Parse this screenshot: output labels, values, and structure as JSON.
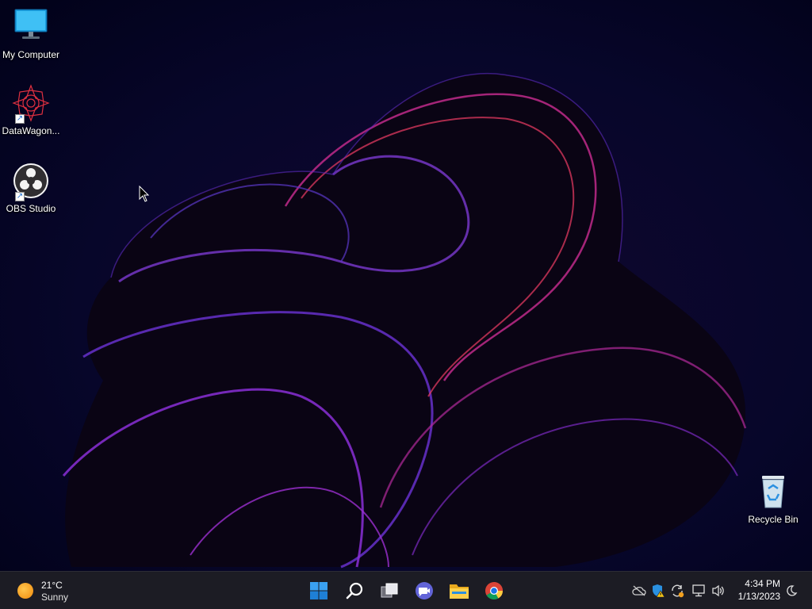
{
  "desktop": {
    "icons": [
      {
        "label": "My Computer",
        "icon": "monitor-icon"
      },
      {
        "label": "DataWagon...",
        "icon": "datawagon-logo-icon"
      },
      {
        "label": "OBS Studio",
        "icon": "obs-studio-icon"
      },
      {
        "label": "Recycle Bin",
        "icon": "recycle-bin-icon"
      }
    ]
  },
  "taskbar": {
    "weather": {
      "temperature": "21°C",
      "condition": "Sunny",
      "icon": "sun-icon"
    },
    "pinned": [
      {
        "name": "Start",
        "icon": "windows-start-icon"
      },
      {
        "name": "Search",
        "icon": "search-icon"
      },
      {
        "name": "Task View",
        "icon": "task-view-icon"
      },
      {
        "name": "Chat",
        "icon": "teams-chat-icon"
      },
      {
        "name": "File Explorer",
        "icon": "folder-icon"
      },
      {
        "name": "Google Chrome",
        "icon": "chrome-icon"
      }
    ],
    "tray": [
      {
        "icon": "cloud-offline-icon"
      },
      {
        "icon": "security-warning-icon"
      },
      {
        "icon": "sync-update-icon"
      },
      {
        "icon": "network-icon"
      },
      {
        "icon": "volume-icon"
      }
    ],
    "clock": {
      "time": "4:34 PM",
      "date": "1/13/2023"
    },
    "notification_icon": "focus-moon-icon"
  },
  "colors": {
    "background": "#03031a",
    "taskbar": "#1c1c24",
    "accent": "#3a8ee6"
  }
}
